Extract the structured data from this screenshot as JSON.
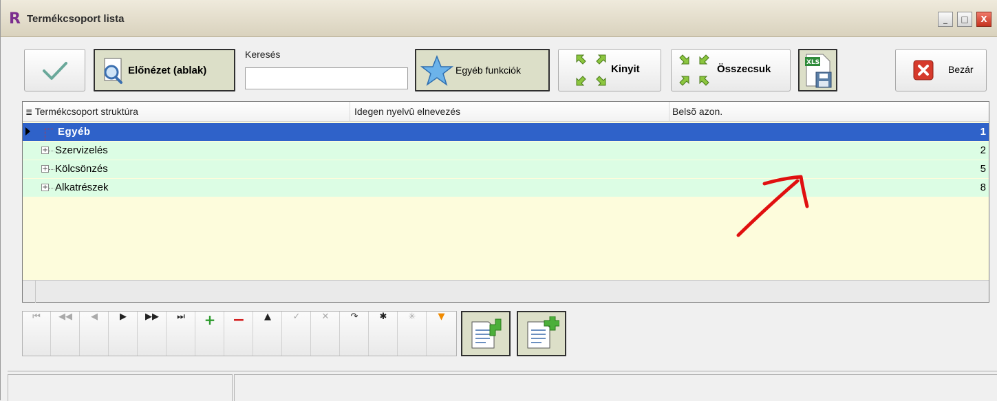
{
  "window": {
    "title": "Termékcsoport lista",
    "logo_letter": "R",
    "min_symbol": "_",
    "max_symbol": "□",
    "close_symbol": "X"
  },
  "toolbar": {
    "preview_label": "Előnézet (ablak)",
    "search_label": "Keresés",
    "search_value": "",
    "other_functions_label": "Egyéb funkciók",
    "expand_label": "Kinyit",
    "collapse_label": "Összecsuk",
    "close_label": "Bezár",
    "xls_badge": "XLS"
  },
  "grid": {
    "columns": [
      "Termékcsoport struktúra",
      "Idegen nyelvû elnevezés",
      "Belsõ azon."
    ],
    "rows": [
      {
        "name": "Egyéb",
        "foreign_name": "",
        "id": "1",
        "selected": true,
        "expandable": false
      },
      {
        "name": "Szervizelés",
        "foreign_name": "",
        "id": "2",
        "selected": false,
        "expandable": true
      },
      {
        "name": "Kölcsönzés",
        "foreign_name": "",
        "id": "5",
        "selected": false,
        "expandable": true
      },
      {
        "name": "Alkatrészek",
        "foreign_name": "",
        "id": "8",
        "selected": false,
        "expandable": true
      }
    ]
  },
  "navigator": {
    "buttons": [
      {
        "name": "first-record-button",
        "glyph": "⏮",
        "enabled": false
      },
      {
        "name": "prior-page-button",
        "glyph": "◀◀",
        "enabled": false
      },
      {
        "name": "prior-record-button",
        "glyph": "◀",
        "enabled": false
      },
      {
        "name": "next-record-button",
        "glyph": "▶",
        "enabled": true
      },
      {
        "name": "next-page-button",
        "glyph": "▶▶",
        "enabled": true
      },
      {
        "name": "last-record-button",
        "glyph": "⏭",
        "enabled": true
      },
      {
        "name": "insert-record-button",
        "glyph": "+",
        "enabled": true
      },
      {
        "name": "delete-record-button",
        "glyph": "−",
        "enabled": true
      },
      {
        "name": "edit-record-button",
        "glyph": "▲",
        "enabled": true
      },
      {
        "name": "post-record-button",
        "glyph": "✓",
        "enabled": false
      },
      {
        "name": "cancel-edit-button",
        "glyph": "✕",
        "enabled": false
      },
      {
        "name": "refresh-button",
        "glyph": "↷",
        "enabled": true
      },
      {
        "name": "bookmark-button",
        "glyph": "✱",
        "enabled": true
      },
      {
        "name": "goto-bookmark-button",
        "glyph": "✳",
        "enabled": false
      },
      {
        "name": "filter-button",
        "glyph": "▼",
        "enabled": true
      }
    ]
  },
  "colors": {
    "selected_row": "#2f62c9",
    "tree_row": "#dcfde4",
    "empty_area": "#fdfcdc",
    "annotation_arrow": "#e01010"
  }
}
